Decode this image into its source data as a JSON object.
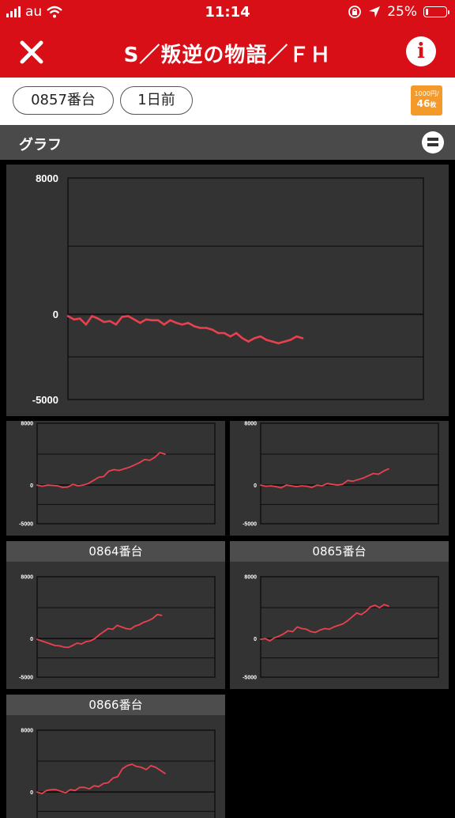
{
  "status_bar": {
    "carrier": "au",
    "time": "11:14",
    "battery_percent": "25%",
    "battery_level": 0.25,
    "icons": [
      "signal-icon",
      "wifi-icon",
      "rotation-lock-icon",
      "location-icon",
      "battery-icon"
    ]
  },
  "nav": {
    "title": "S／叛逆の物語／ＦＨ",
    "close_icon": "close-icon",
    "info_label": "i"
  },
  "toolbar": {
    "unit_label": "0857番台",
    "day_label": "1日前",
    "coin_top": "1000円/",
    "coin_bottom": "46",
    "coin_suffix": "枚",
    "coin_color": "#f39a2b"
  },
  "section": {
    "title": "グラフ",
    "toggle_icon": "list-toggle-icon"
  },
  "colors": {
    "brand": "#d90f17",
    "line": "#e8414f",
    "panel": "#333333",
    "grid": "#111111"
  },
  "charts": {
    "main": {
      "ylabels": [
        "8000",
        "0",
        "-5000"
      ],
      "chart_data": {
        "type": "line",
        "ylim": [
          -5000,
          8000
        ],
        "values": [
          -100,
          -300,
          -250,
          -600,
          -100,
          -250,
          -450,
          -400,
          -600,
          -150,
          -100,
          -300,
          -500,
          -300,
          -350,
          -350,
          -600,
          -350,
          -500,
          -600,
          -500,
          -700,
          -800,
          -800,
          -900,
          -1100,
          -1100,
          -1300,
          -1100,
          -1400,
          -1600,
          -1400,
          -1300,
          -1500,
          -1600,
          -1700,
          -1600,
          -1500,
          -1300,
          -1400
        ]
      }
    },
    "small": [
      {
        "ylabels": [
          "8000",
          "0",
          "-5000"
        ],
        "chart_data": {
          "type": "line",
          "ylim": [
            -5000,
            8000
          ],
          "values": [
            0,
            -150,
            0,
            -50,
            -100,
            -300,
            -250,
            100,
            -100,
            0,
            200,
            600,
            1000,
            1100,
            1800,
            2000,
            1900,
            2100,
            2300,
            2600,
            2900,
            3300,
            3200,
            3600,
            4200,
            4000
          ]
        }
      },
      {
        "ylabels": [
          "8000",
          "0",
          "-5000"
        ],
        "chart_data": {
          "type": "line",
          "ylim": [
            -5000,
            8000
          ],
          "values": [
            0,
            -150,
            -100,
            -200,
            -350,
            0,
            -100,
            -200,
            -100,
            -150,
            -300,
            0,
            -100,
            200,
            100,
            0,
            100,
            600,
            500,
            700,
            900,
            1200,
            1500,
            1400,
            1800,
            2100
          ]
        }
      },
      {
        "label": "0864番台",
        "ylabels": [
          "8000",
          "0",
          "-5000"
        ],
        "chart_data": {
          "type": "line",
          "ylim": [
            -5000,
            8000
          ],
          "values": [
            -100,
            -300,
            -500,
            -700,
            -900,
            -950,
            -1100,
            -1150,
            -900,
            -600,
            -700,
            -400,
            -300,
            0,
            500,
            900,
            1300,
            1200,
            1700,
            1500,
            1300,
            1200,
            1600,
            1800,
            2100,
            2300,
            2600,
            3100,
            3000
          ]
        }
      },
      {
        "label": "0865番台",
        "ylabels": [
          "8000",
          "0",
          "-5000"
        ],
        "chart_data": {
          "type": "line",
          "ylim": [
            -5000,
            8000
          ],
          "values": [
            -100,
            0,
            -300,
            100,
            300,
            600,
            1000,
            900,
            1500,
            1300,
            1200,
            900,
            800,
            1100,
            1300,
            1200,
            1500,
            1700,
            1900,
            2300,
            2800,
            3300,
            3100,
            3500,
            4100,
            4300,
            4000,
            4400,
            4200
          ]
        }
      },
      {
        "label": "0866番台",
        "ylabels": [
          "8000",
          "0",
          "-5000"
        ],
        "chart_data": {
          "type": "line",
          "ylim": [
            -5000,
            8000
          ],
          "values": [
            0,
            -200,
            200,
            300,
            300,
            100,
            -100,
            300,
            200,
            600,
            600,
            400,
            800,
            700,
            1100,
            1200,
            1800,
            2000,
            3000,
            3400,
            3600,
            3300,
            3200,
            2900,
            3400,
            3200,
            2800,
            2400
          ]
        }
      }
    ]
  }
}
